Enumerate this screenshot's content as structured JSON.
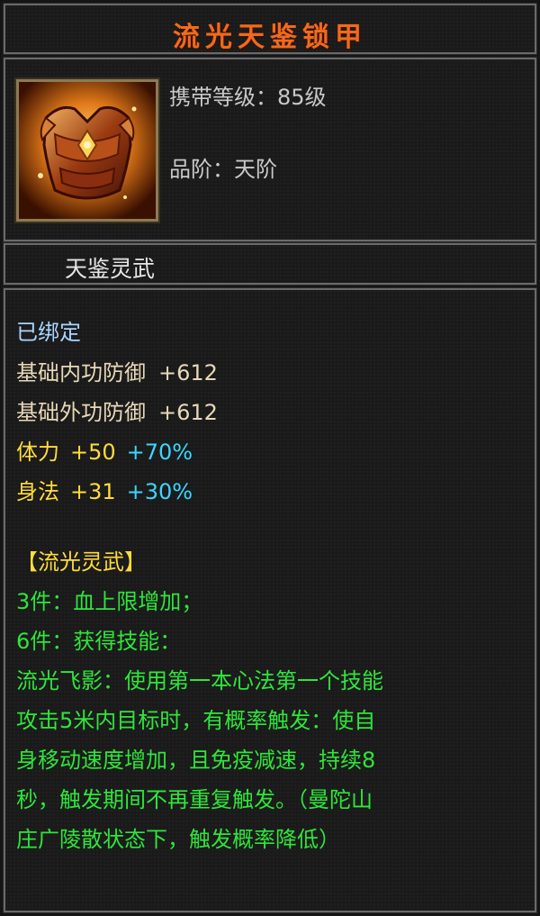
{
  "item": {
    "name": "流光天鉴锁甲",
    "level_label": "携带等级：",
    "level_value": "85级",
    "grade_label": "品阶：",
    "grade_value": "天阶",
    "icon": "golden-armor-icon",
    "set_name": "天鉴灵武"
  },
  "bound": "已绑定",
  "base_attrs": [
    {
      "name": "基础内功防御",
      "value": "+612"
    },
    {
      "name": "基础外功防御",
      "value": "+612"
    }
  ],
  "bonus_attrs": [
    {
      "name": "体力",
      "value": "+50",
      "percent": "+70%"
    },
    {
      "name": "身法",
      "value": "+31",
      "percent": "+30%"
    }
  ],
  "set": {
    "header": "【流光灵武】",
    "lines": [
      "3件：血上限增加；",
      "6件：获得技能：",
      "流光飞影：使用第一本心法第一个技能",
      "攻击5米内目标时，有概率触发：使自",
      "身移动速度增加，且免疫减速，持续8",
      "秒，触发期间不再重复触发。（曼陀山",
      "庄广陵散状态下，触发概率降低）"
    ]
  },
  "colors": {
    "title": "#f06a1e",
    "bound": "#a8d6ff",
    "base": "#e8d8b8",
    "yellow": "#ffdc3a",
    "cyan": "#3ad6ff",
    "green": "#2ee63a"
  }
}
